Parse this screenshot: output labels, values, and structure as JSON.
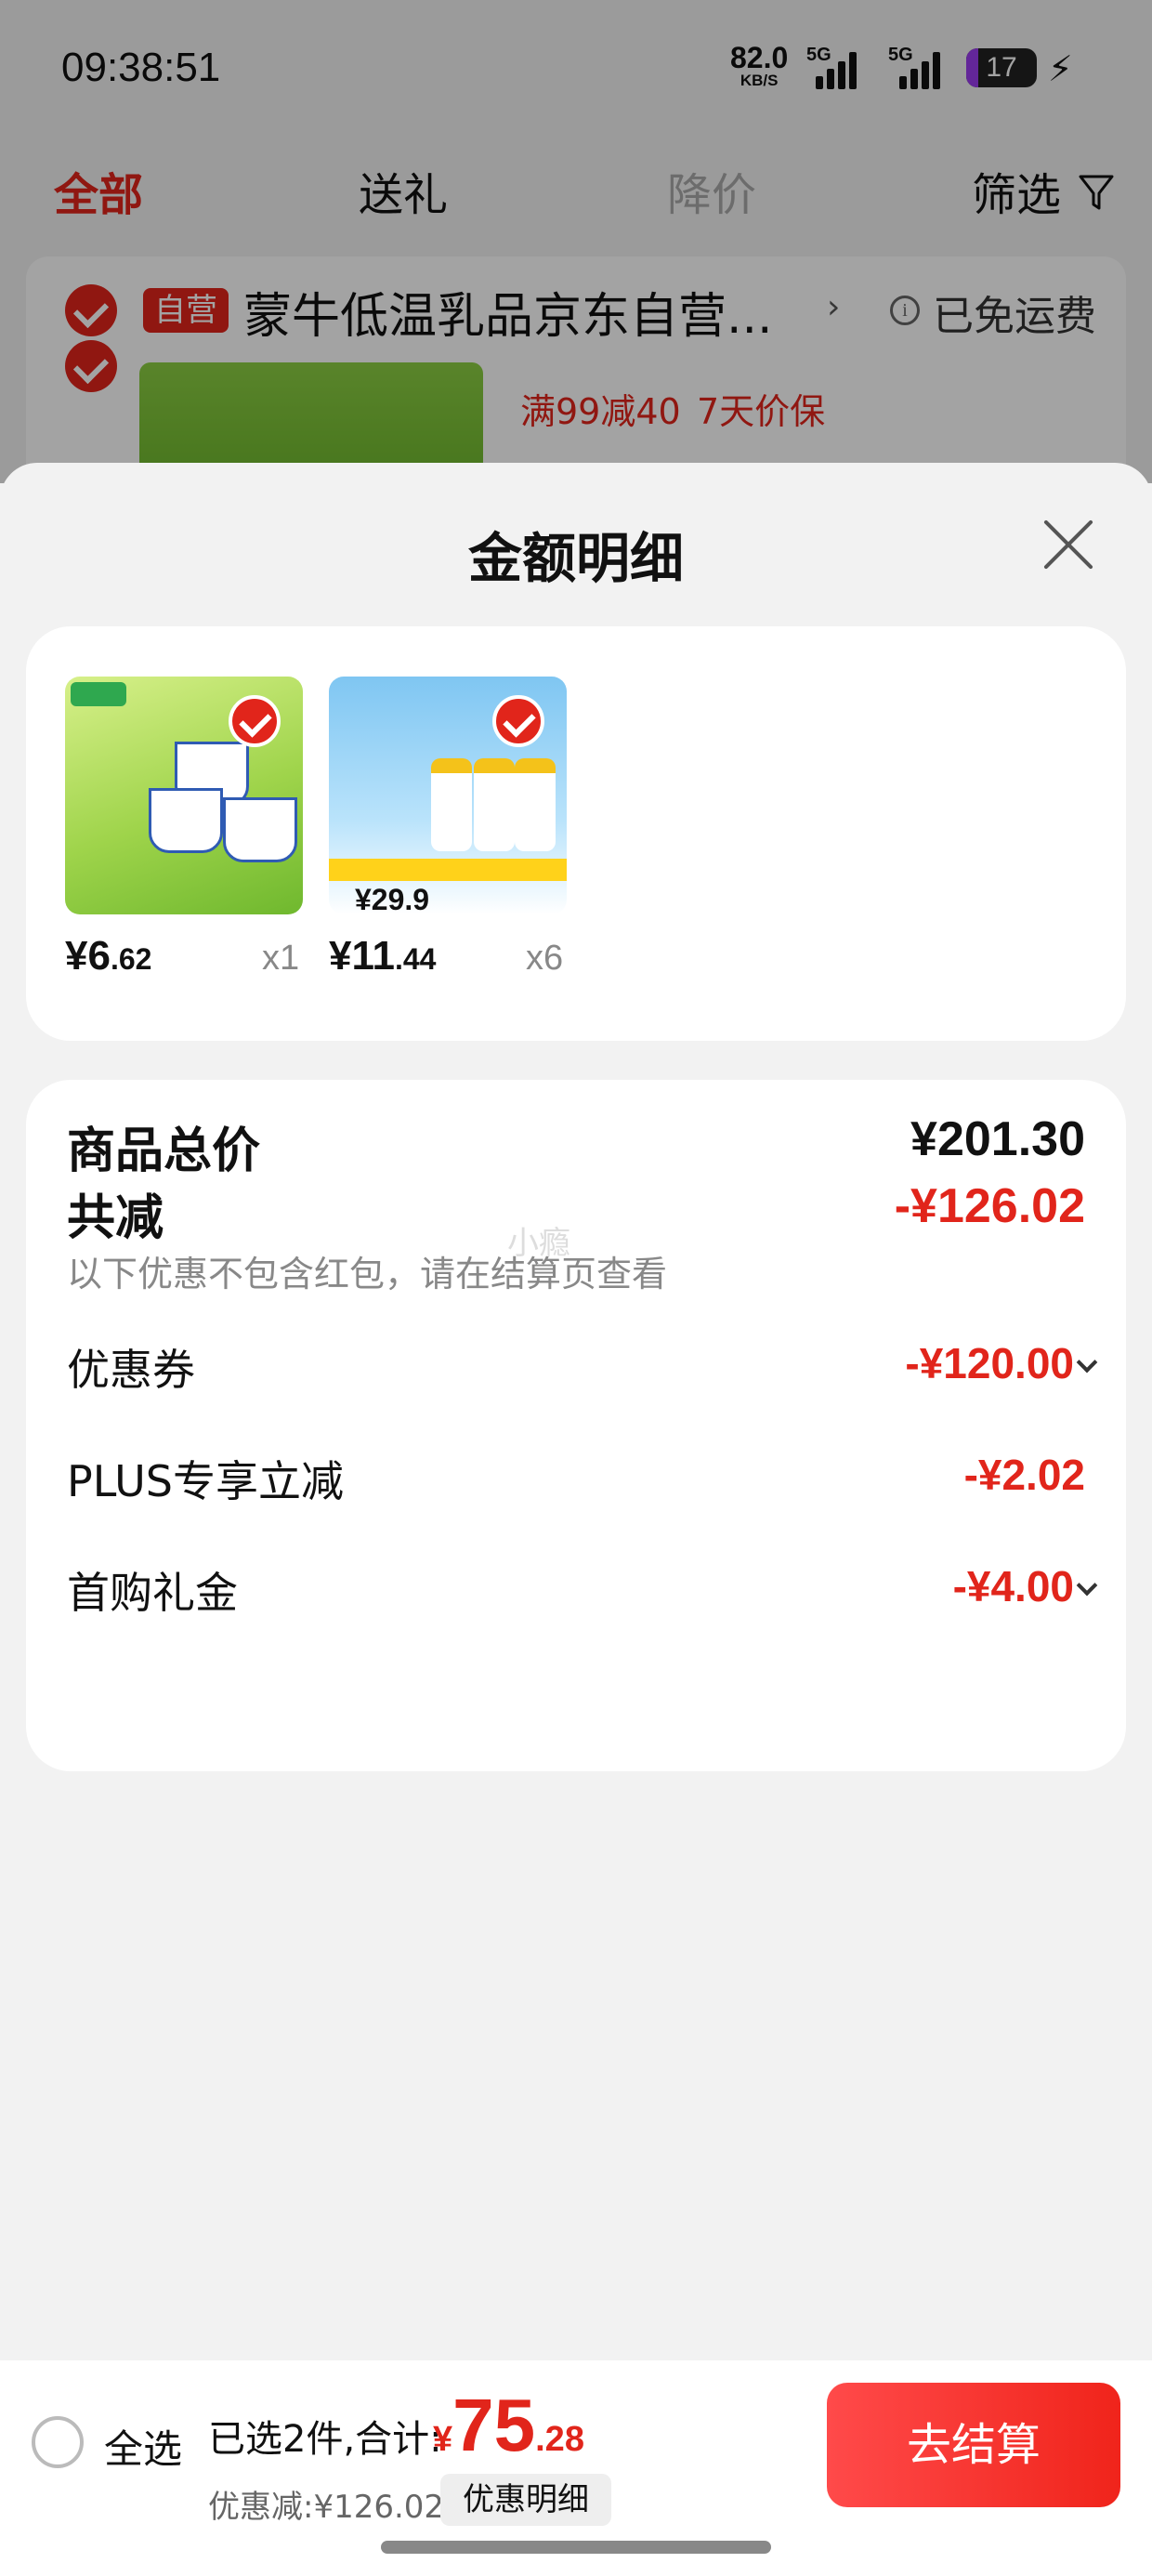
{
  "status_bar": {
    "time": "09:38:51",
    "net_speed_value": "82.0",
    "net_speed_unit": "KB/S",
    "signal_label_1": "5G",
    "signal_label_2": "5G",
    "battery_level": "17"
  },
  "tabs": [
    {
      "label": "全部",
      "active": true
    },
    {
      "label": "送礼",
      "active": false
    },
    {
      "label": "降价",
      "active": false,
      "disabled": true
    },
    {
      "label": "筛选",
      "active": false
    }
  ],
  "store": {
    "badge": "自营",
    "name": "蒙牛低温乳品京东自营...",
    "shipping": "已免运费",
    "promo_1": "满99减40",
    "promo_2": "7天价保"
  },
  "sheet": {
    "title": "金额明细",
    "products": [
      {
        "price_int": "¥6",
        "price_dec": ".62",
        "qty": "x1",
        "image": "yogurt-cups"
      },
      {
        "price_int": "¥11",
        "price_dec": ".44",
        "qty": "x6",
        "image": "milk-bottles",
        "image_price": "29.9"
      }
    ],
    "summary": {
      "total_label": "商品总价",
      "total_value": "¥201.30",
      "reduce_label": "共减",
      "reduce_value": "-¥126.02",
      "note": "以下优惠不包含红包，请在结算页查看",
      "watermark": "小瘾",
      "items": [
        {
          "label": "优惠券",
          "value": "-¥120.00",
          "expandable": true
        },
        {
          "label": "PLUS专享立减",
          "value": "-¥2.02",
          "expandable": false
        },
        {
          "label": "首购礼金",
          "value": "-¥4.00",
          "expandable": true
        }
      ]
    }
  },
  "bottom_bar": {
    "select_all": "全选",
    "selected": "已选2件,合计:",
    "total_currency": "¥",
    "total_int": "75",
    "total_dec": ".28",
    "discount": "优惠减:¥126.02",
    "detail_button": "优惠明细",
    "checkout_button": "去结算"
  },
  "colors": {
    "accent": "#e1251b",
    "background": "#f2f2f2"
  }
}
